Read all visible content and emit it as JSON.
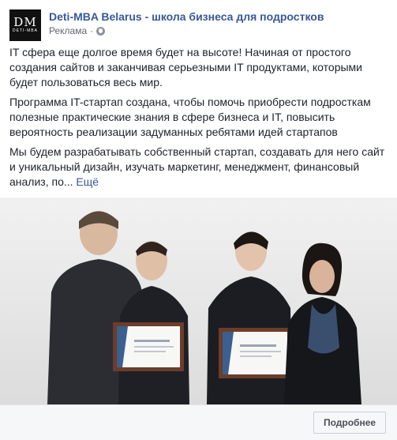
{
  "header": {
    "avatar_big": "DM",
    "avatar_small": "DETI-MBA",
    "page_name": "Deti-MBA Belarus - школа бизнеса для подростков",
    "sponsored": "Реклама",
    "privacy_icon": "globe-icon"
  },
  "post": {
    "paragraph_1": "IT сфера еще долгое время будет на высоте! Начиная от простого создания сайтов и заканчивая серьезными IT продуктами, которыми будет пользоваться весь мир.",
    "paragraph_2": "Программа IT-стартап создана, чтобы помочь приобрести подросткам полезные практические знания в сфере бизнеса и IT, повысить вероятность реализации задуманных ребятами идей стартапов",
    "paragraph_3": "Мы будем разрабатывать собственный стартап, создавать для него сайт и уникальный дизайн, изучать маркетинг, менеджмент, финансовый анализ, по...",
    "more_link": "Ещё"
  },
  "footer": {
    "cta_label": "Подробнее"
  }
}
